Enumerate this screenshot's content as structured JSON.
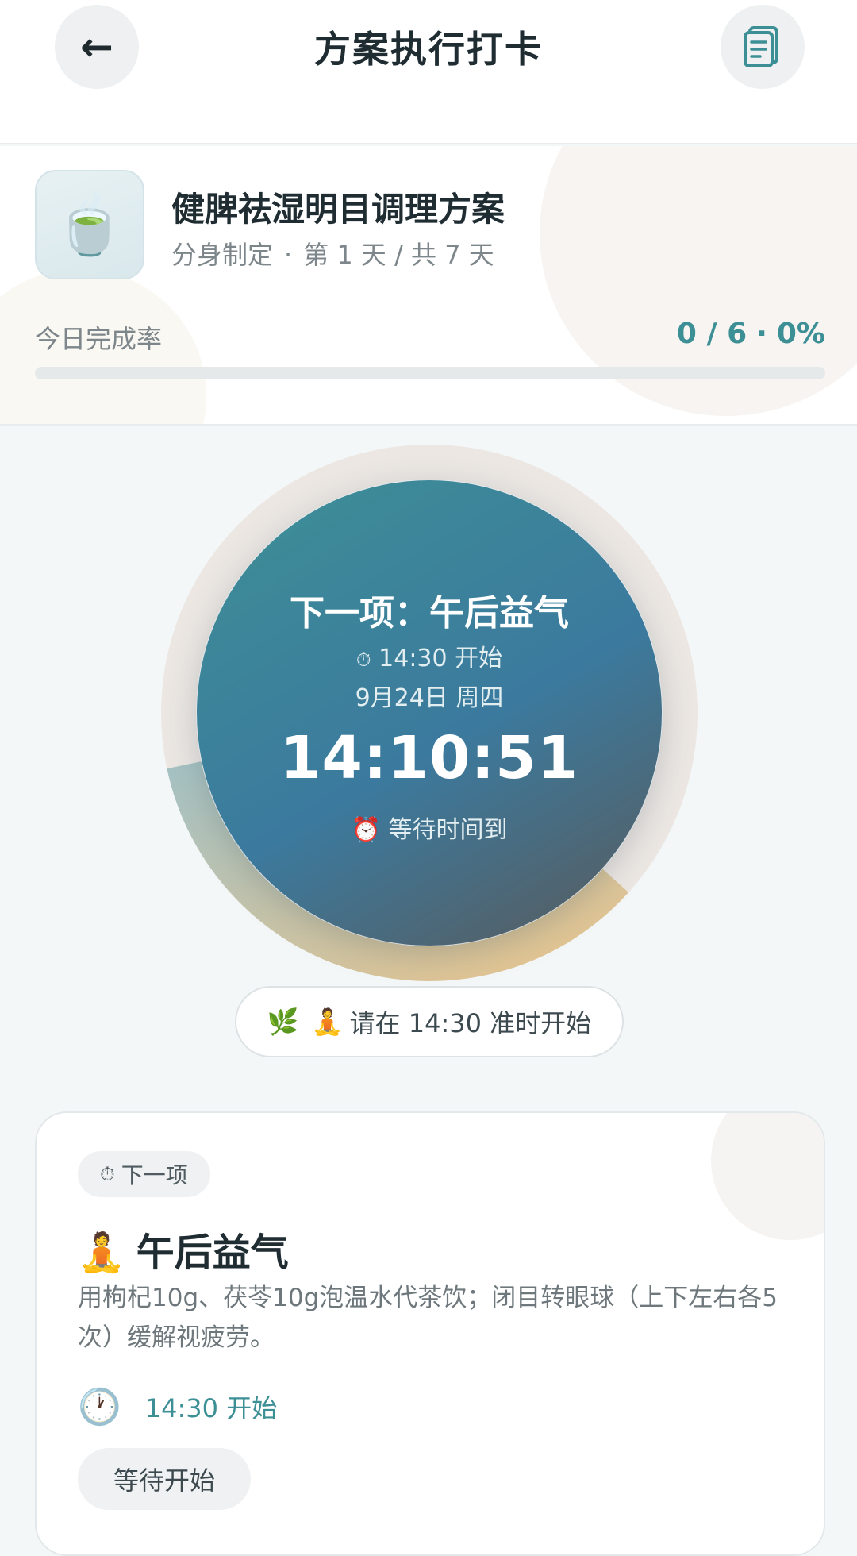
{
  "header": {
    "title": "方案执行打卡",
    "back_icon": "←"
  },
  "plan": {
    "icon": "🍵",
    "name": "健脾祛湿明目调理方案",
    "source": "分身制定",
    "separator": "·",
    "day_info": "第 1 天 / 共 7 天",
    "rate_label": "今日完成率",
    "rate_count": "0 / 6",
    "rate_percent": "0%",
    "progress_fraction": 0
  },
  "timer": {
    "next_label": "下一项：午后益气",
    "start_icon": "⏱",
    "start_time": "14:30 开始",
    "date": "9月24日 周四",
    "clock": "14:10:51",
    "wait_icon": "⏰",
    "wait_text": "等待时间到",
    "ring_elapsed_fraction": 0.35
  },
  "hint": {
    "icon_leaf": "🌿",
    "icon_person": "🧘",
    "text": "请在 14:30 准时开始"
  },
  "task": {
    "chip_icon": "⏱",
    "chip_label": "下一项",
    "title_icon": "🧘",
    "title": "午后益气",
    "description": "用枸杞10g、茯苓10g泡温水代茶饮；闭目转眼球（上下左右各5次）缓解视疲劳。",
    "clock_icon": "🕐",
    "time_text": "14:30 开始",
    "action_label": "等待开始"
  },
  "colors": {
    "accent": "#3d8f96",
    "ring_start": "#a6c2c3",
    "ring_end": "#e8c58e"
  }
}
